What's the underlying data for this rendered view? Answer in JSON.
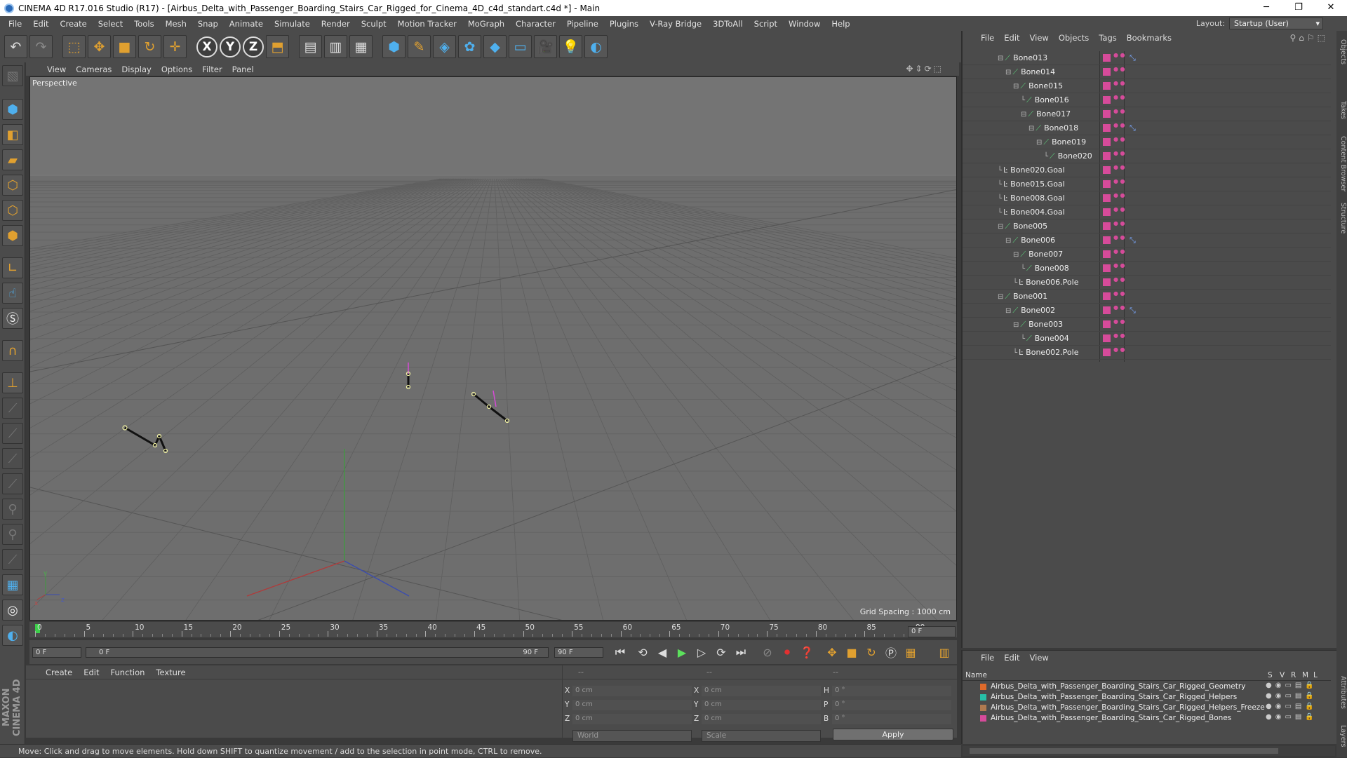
{
  "window": {
    "title": "CINEMA 4D R17.016 Studio (R17) - [Airbus_Delta_with_Passenger_Boarding_Stairs_Car_Rigged_for_Cinema_4D_c4d_standart.c4d *] - Main",
    "minimize": "─",
    "restore": "❐",
    "close": "✕"
  },
  "menubar": [
    "File",
    "Edit",
    "Create",
    "Select",
    "Tools",
    "Mesh",
    "Snap",
    "Animate",
    "Simulate",
    "Render",
    "Sculpt",
    "Motion Tracker",
    "MoGraph",
    "Character",
    "Pipeline",
    "Plugins",
    "V-Ray Bridge",
    "3DToAll",
    "Script",
    "Window",
    "Help"
  ],
  "layout": {
    "label": "Layout:",
    "value": "Startup (User)"
  },
  "toolbar": {
    "x": "X",
    "y": "Y",
    "z": "Z"
  },
  "viewport": {
    "menu": [
      "View",
      "Cameras",
      "Display",
      "Options",
      "Filter",
      "Panel"
    ],
    "label": "Perspective",
    "grid_spacing": "Grid Spacing : 1000 cm",
    "axis": {
      "x": "x",
      "y": "y",
      "z": "z"
    }
  },
  "timeline": {
    "ticks": [
      "0",
      "5",
      "10",
      "15",
      "20",
      "25",
      "30",
      "35",
      "40",
      "45",
      "50",
      "55",
      "60",
      "65",
      "70",
      "75",
      "80",
      "85",
      "90"
    ],
    "frame_end": "0 F"
  },
  "playbar": {
    "current": "0 F",
    "range_start": "0 F",
    "range_end": "90 F",
    "max": "90 F"
  },
  "material": {
    "menu": [
      "Create",
      "Edit",
      "Function",
      "Texture"
    ],
    "brand": "MAXON CINEMA 4D"
  },
  "coords": {
    "header": [
      "--",
      "--",
      "--"
    ],
    "rows": [
      {
        "a": "X",
        "av": "0 cm",
        "b": "X",
        "bv": "0 cm",
        "c": "H",
        "cv": "0 °"
      },
      {
        "a": "Y",
        "av": "0 cm",
        "b": "Y",
        "bv": "0 cm",
        "c": "P",
        "cv": "0 °"
      },
      {
        "a": "Z",
        "av": "0 cm",
        "b": "Z",
        "bv": "0 cm",
        "c": "B",
        "cv": "0 °"
      }
    ],
    "space": "World",
    "mode": "Scale",
    "apply": "Apply"
  },
  "objects": {
    "menu": [
      "File",
      "Edit",
      "View",
      "Objects",
      "Tags",
      "Bookmarks"
    ],
    "items": [
      {
        "name": "Bone013",
        "type": "bone",
        "fold": true,
        "tag": true
      },
      {
        "name": "Bone014",
        "type": "bone",
        "fold": true,
        "tag": false
      },
      {
        "name": "Bone015",
        "type": "bone",
        "fold": true,
        "tag": false
      },
      {
        "name": "Bone016",
        "type": "bone",
        "fold": false,
        "tag": false
      },
      {
        "name": "Bone017",
        "type": "bone",
        "fold": true,
        "tag": false
      },
      {
        "name": "Bone018",
        "type": "bone",
        "fold": true,
        "tag": true
      },
      {
        "name": "Bone019",
        "type": "bone",
        "fold": true,
        "tag": false
      },
      {
        "name": "Bone020",
        "type": "bone",
        "fold": false,
        "tag": false
      },
      {
        "name": "Bone020.Goal",
        "type": "goal",
        "fold": false,
        "tag": false
      },
      {
        "name": "Bone015.Goal",
        "type": "goal",
        "fold": false,
        "tag": false
      },
      {
        "name": "Bone008.Goal",
        "type": "goal",
        "fold": false,
        "tag": false
      },
      {
        "name": "Bone004.Goal",
        "type": "goal",
        "fold": false,
        "tag": false
      },
      {
        "name": "Bone005",
        "type": "bone",
        "fold": true,
        "tag": false
      },
      {
        "name": "Bone006",
        "type": "bone",
        "fold": true,
        "tag": true
      },
      {
        "name": "Bone007",
        "type": "bone",
        "fold": true,
        "tag": false
      },
      {
        "name": "Bone008",
        "type": "bone",
        "fold": false,
        "tag": false
      },
      {
        "name": "Bone006.Pole",
        "type": "goal",
        "fold": false,
        "tag": false
      },
      {
        "name": "Bone001",
        "type": "bone",
        "fold": true,
        "tag": false
      },
      {
        "name": "Bone002",
        "type": "bone",
        "fold": true,
        "tag": true
      },
      {
        "name": "Bone003",
        "type": "bone",
        "fold": true,
        "tag": false
      },
      {
        "name": "Bone004",
        "type": "bone",
        "fold": false,
        "tag": false
      },
      {
        "name": "Bone002.Pole",
        "type": "goal",
        "fold": false,
        "tag": false
      }
    ]
  },
  "layers": {
    "menu": [
      "File",
      "Edit",
      "View"
    ],
    "header": {
      "name": "Name",
      "s": "S",
      "v": "V",
      "r": "R",
      "m": "M",
      "l": "L"
    },
    "items": [
      {
        "name": "Airbus_Delta_with_Passenger_Boarding_Stairs_Car_Rigged_Geometry",
        "color": "#e06a2a"
      },
      {
        "name": "Airbus_Delta_with_Passenger_Boarding_Stairs_Car_Rigged_Helpers",
        "color": "#27c0a8"
      },
      {
        "name": "Airbus_Delta_with_Passenger_Boarding_Stairs_Car_Rigged_Helpers_Freeze",
        "color": "#b07a50"
      },
      {
        "name": "Airbus_Delta_with_Passenger_Boarding_Stairs_Car_Rigged_Bones",
        "color": "#d64b9a"
      }
    ]
  },
  "right_tabs": [
    "Objects",
    "Takes",
    "Content Browser",
    "Structure",
    "Attributes",
    "Layers"
  ],
  "status": "Move: Click and drag to move elements. Hold down SHIFT to quantize movement / add to the selection in point mode, CTRL to remove."
}
